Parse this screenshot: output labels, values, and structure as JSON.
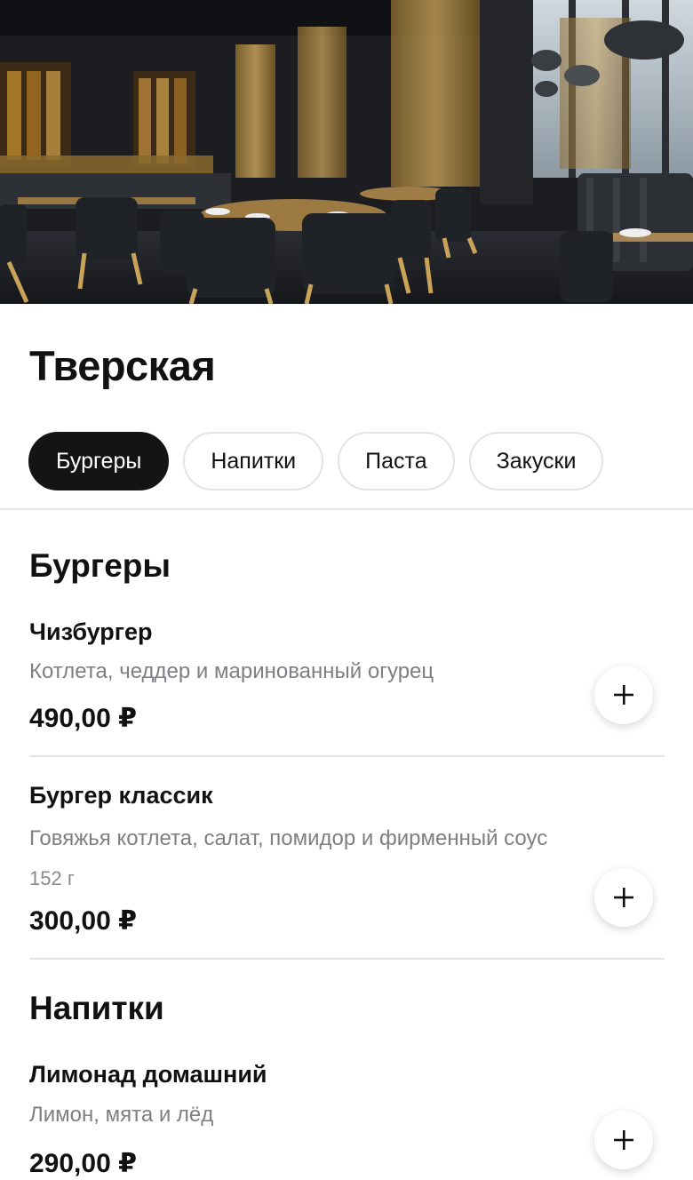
{
  "venue": {
    "title": "Тверская"
  },
  "hero": {
    "image": "restaurant-interior-photo"
  },
  "tabs": [
    {
      "label": "Бургеры",
      "active": true
    },
    {
      "label": "Напитки",
      "active": false
    },
    {
      "label": "Паста",
      "active": false
    },
    {
      "label": "Закуски",
      "active": false
    }
  ],
  "sections": [
    {
      "title": "Бургеры",
      "items": [
        {
          "name": "Чизбургер",
          "description": "Котлета, чеддер и маринованный огурец",
          "price": "490,00 ₽",
          "add_icon": "plus-icon"
        },
        {
          "name": "Бургер классик",
          "description": "Говяжья котлета, салат, помидор и фирменный соус",
          "weight": "152 г",
          "price": "300,00 ₽",
          "add_icon": "plus-icon"
        }
      ]
    },
    {
      "title": "Напитки",
      "items": [
        {
          "name": "Лимонад домашний",
          "description": "Лимон, мята и лёд",
          "price": "290,00 ₽",
          "add_icon": "plus-icon"
        }
      ]
    }
  ],
  "colors": {
    "active_tab_bg": "#141414",
    "muted_text": "#7e7e84",
    "divider": "#e3e3e3"
  }
}
